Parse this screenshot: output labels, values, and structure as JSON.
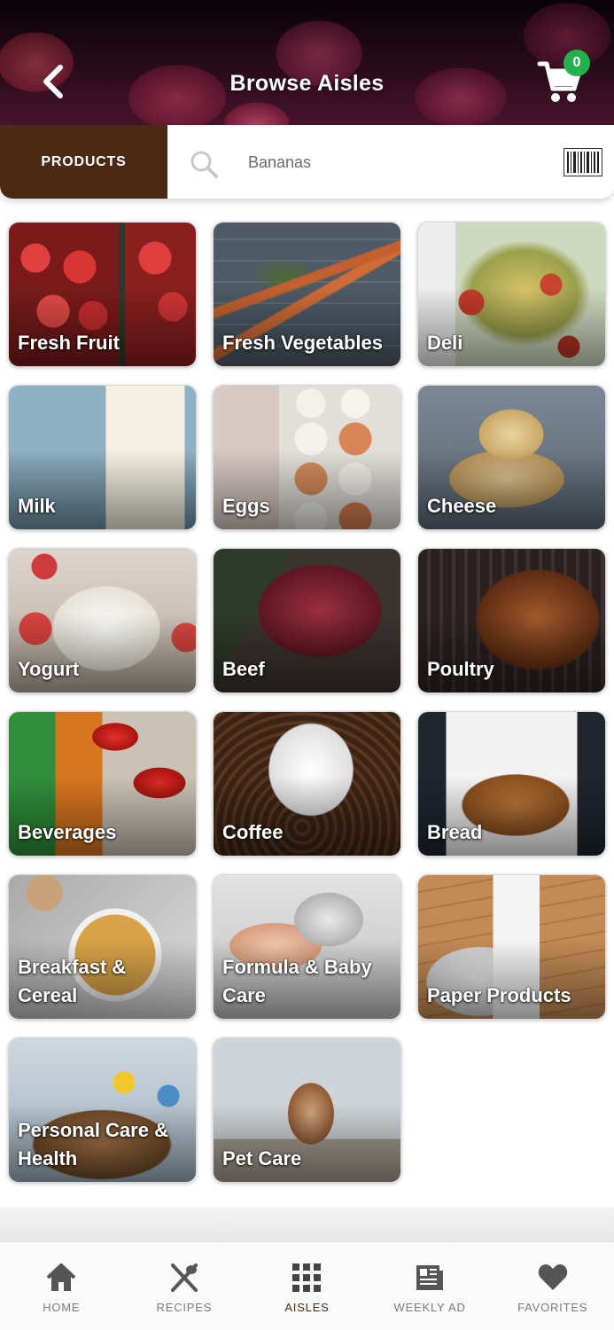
{
  "header": {
    "title": "Browse Aisles",
    "back_icon": "chevron-left-icon",
    "cart_icon": "shopping-cart-icon",
    "cart_count": "0"
  },
  "search": {
    "tab_label": "PRODUCTS",
    "placeholder": "Bananas",
    "value": "",
    "search_icon": "search-icon",
    "barcode_icon": "barcode-icon"
  },
  "aisles": [
    {
      "label": "Fresh Fruit"
    },
    {
      "label": "Fresh Vegetables"
    },
    {
      "label": "Deli"
    },
    {
      "label": "Milk"
    },
    {
      "label": "Eggs"
    },
    {
      "label": "Cheese"
    },
    {
      "label": "Yogurt"
    },
    {
      "label": "Beef"
    },
    {
      "label": "Poultry"
    },
    {
      "label": "Beverages"
    },
    {
      "label": "Coffee"
    },
    {
      "label": "Bread"
    },
    {
      "label": "Breakfast & Cereal"
    },
    {
      "label": "Formula & Baby Care"
    },
    {
      "label": "Paper Products"
    },
    {
      "label": "Personal Care & Health"
    },
    {
      "label": "Pet Care"
    }
  ],
  "nav": {
    "items": [
      {
        "label": "HOME",
        "icon": "home-icon"
      },
      {
        "label": "RECIPES",
        "icon": "utensils-icon"
      },
      {
        "label": "AISLES",
        "icon": "grid-icon"
      },
      {
        "label": "WEEKLY AD",
        "icon": "newspaper-icon"
      },
      {
        "label": "FAVORITES",
        "icon": "heart-icon"
      }
    ],
    "active": "AISLES"
  },
  "colors": {
    "brand_brown": "#4a2a14",
    "cart_badge": "#21b24b",
    "nav_icon": "#555555"
  }
}
